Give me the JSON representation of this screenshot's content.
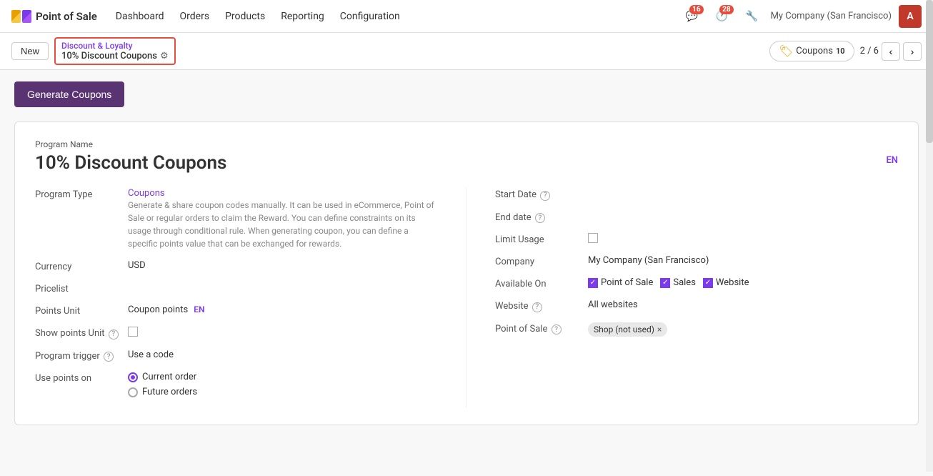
{
  "app": {
    "logo_text": "Point of Sale",
    "nav_items": [
      "Dashboard",
      "Orders",
      "Products",
      "Reporting",
      "Configuration"
    ],
    "notif1_count": "16",
    "notif2_count": "28",
    "company": "My Company (San Francisco)",
    "avatar_initials": "A"
  },
  "secondnav": {
    "new_label": "New",
    "breadcrumb_top": "Discount & Loyalty",
    "breadcrumb_bottom": "10% Discount Coupons",
    "coupons_label": "Coupons",
    "coupons_count": "10",
    "pagination": "2 / 6"
  },
  "toolbar": {
    "generate_coupons": "Generate Coupons"
  },
  "form": {
    "program_name_label": "Program Name",
    "program_name": "10% Discount Coupons",
    "en_label": "EN",
    "program_type_label": "Program Type",
    "program_type_value": "Coupons",
    "program_type_desc": "Generate & share coupon codes manually. It can be used in eCommerce, Point of Sale or regular orders to claim the Reward. You can define constraints on its usage through conditional rule. When generating coupon, you can define a specific points value that can be exchanged for rewards.",
    "currency_label": "Currency",
    "currency_value": "USD",
    "pricelist_label": "Pricelist",
    "pricelist_value": "",
    "points_unit_label": "Points Unit",
    "points_unit_value": "Coupon points",
    "points_unit_en": "EN",
    "show_points_label": "Show points Unit",
    "show_points_tooltip": "?",
    "program_trigger_label": "Program trigger",
    "program_trigger_tooltip": "?",
    "program_trigger_value": "Use a code",
    "use_points_label": "Use points on",
    "use_points_option1": "Current order",
    "use_points_option2": "Future orders",
    "start_date_label": "Start Date",
    "start_date_tooltip": "?",
    "end_date_label": "End date",
    "end_date_tooltip": "?",
    "limit_usage_label": "Limit Usage",
    "company_label": "Company",
    "company_value": "My Company (San Francisco)",
    "available_on_label": "Available On",
    "available_pos": "Point of Sale",
    "available_sales": "Sales",
    "available_website": "Website",
    "website_label": "Website",
    "website_tooltip": "?",
    "website_value": "All websites",
    "point_of_sale_label": "Point of Sale",
    "point_of_sale_tooltip": "?",
    "point_of_sale_tag": "Shop (not used)"
  }
}
